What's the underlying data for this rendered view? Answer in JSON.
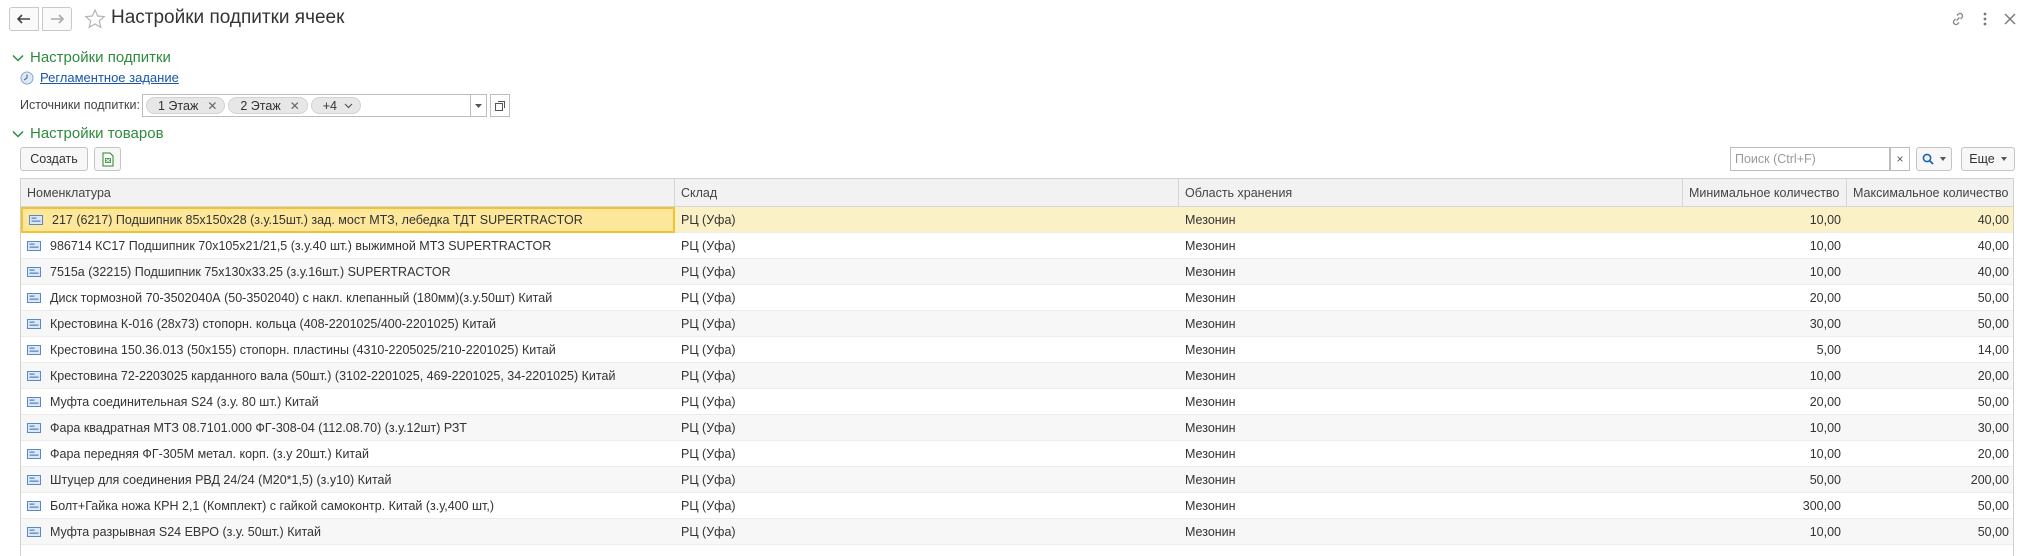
{
  "window": {
    "title": "Настройки подпитки ячеек"
  },
  "groups": {
    "replenish": {
      "title": "Настройки подпитки",
      "scheduled_task_link": "Регламентное задание",
      "sources_label": "Источники подпитки:",
      "sources_tags": [
        "1 Этаж",
        "2 Этаж"
      ],
      "sources_more": "+4"
    },
    "goods": {
      "title": "Настройки товаров"
    }
  },
  "toolbar": {
    "create_label": "Создать",
    "search_placeholder": "Поиск (Ctrl+F)",
    "search_clear": "×",
    "more_label": "Еще"
  },
  "table": {
    "columns": [
      "Номенклатура",
      "Склад",
      "Область хранения",
      "Минимальное количество",
      "Максимальное количество"
    ],
    "rows": [
      {
        "item": "217 (6217) Подшипник 85х150х28 (з.у.15шт.) зад. мост МТЗ, лебедка ТДТ SUPERTRACTOR",
        "warehouse": "РЦ (Уфа)",
        "area": "Мезонин",
        "min": "10,00",
        "max": "40,00"
      },
      {
        "item": "986714 КС17 Подшипник 70х105х21/21,5 (з.у.40 шт.) выжимной МТЗ SUPERTRACTOR",
        "warehouse": "РЦ (Уфа)",
        "area": "Мезонин",
        "min": "10,00",
        "max": "40,00"
      },
      {
        "item": "7515а (32215) Подшипник 75х130х33.25 (з.у.16шт.) SUPERTRACTOR",
        "warehouse": "РЦ (Уфа)",
        "area": "Мезонин",
        "min": "10,00",
        "max": "40,00"
      },
      {
        "item": "Диск тормозной 70-3502040А (50-3502040) с накл. клепанный (180мм)(з.у.50шт) Китай",
        "warehouse": "РЦ (Уфа)",
        "area": "Мезонин",
        "min": "20,00",
        "max": "50,00"
      },
      {
        "item": "Крестовина К-016 (28х73) стопорн. кольца (408-2201025/400-2201025) Китай",
        "warehouse": "РЦ (Уфа)",
        "area": "Мезонин",
        "min": "30,00",
        "max": "50,00"
      },
      {
        "item": "Крестовина 150.36.013 (50х155) стопорн. пластины (4310-2205025/210-2201025) Китай",
        "warehouse": "РЦ (Уфа)",
        "area": "Мезонин",
        "min": "5,00",
        "max": "14,00"
      },
      {
        "item": "Крестовина 72-2203025 карданного вала (50шт.) (3102-2201025, 469-2201025, 34-2201025) Китай",
        "warehouse": "РЦ (Уфа)",
        "area": "Мезонин",
        "min": "10,00",
        "max": "20,00"
      },
      {
        "item": "Муфта соединительная S24 (з.у. 80 шт.) Китай",
        "warehouse": "РЦ (Уфа)",
        "area": "Мезонин",
        "min": "20,00",
        "max": "50,00"
      },
      {
        "item": "Фара квадратная МТЗ 08.7101.000 ФГ-308-04 (112.08.70) (з.у.12шт) РЗТ",
        "warehouse": "РЦ (Уфа)",
        "area": "Мезонин",
        "min": "10,00",
        "max": "30,00"
      },
      {
        "item": "Фара передняя ФГ-305М метал. корп. (з.у 20шт.) Китай",
        "warehouse": "РЦ (Уфа)",
        "area": "Мезонин",
        "min": "10,00",
        "max": "20,00"
      },
      {
        "item": "Штуцер для соединения РВД 24/24 (М20*1,5) (з.у10) Китай",
        "warehouse": "РЦ (Уфа)",
        "area": "Мезонин",
        "min": "50,00",
        "max": "200,00"
      },
      {
        "item": "Болт+Гайка ножа КРН 2,1 (Комплект) с гайкой самоконтр. Китай  (з.у,400 шт,)",
        "warehouse": "РЦ (Уфа)",
        "area": "Мезонин",
        "min": "300,00",
        "max": "50,00"
      },
      {
        "item": "Муфта разрывная S24 ЕВРО (з.у. 50шт.) Китай",
        "warehouse": "РЦ (Уфа)",
        "area": "Мезонин",
        "min": "10,00",
        "max": "50,00"
      }
    ]
  },
  "colors": {
    "group_header": "#2e8b3e",
    "link": "#1a55a8",
    "selected_row": "#fbf1c6",
    "selected_cell_border": "#f1c232"
  }
}
